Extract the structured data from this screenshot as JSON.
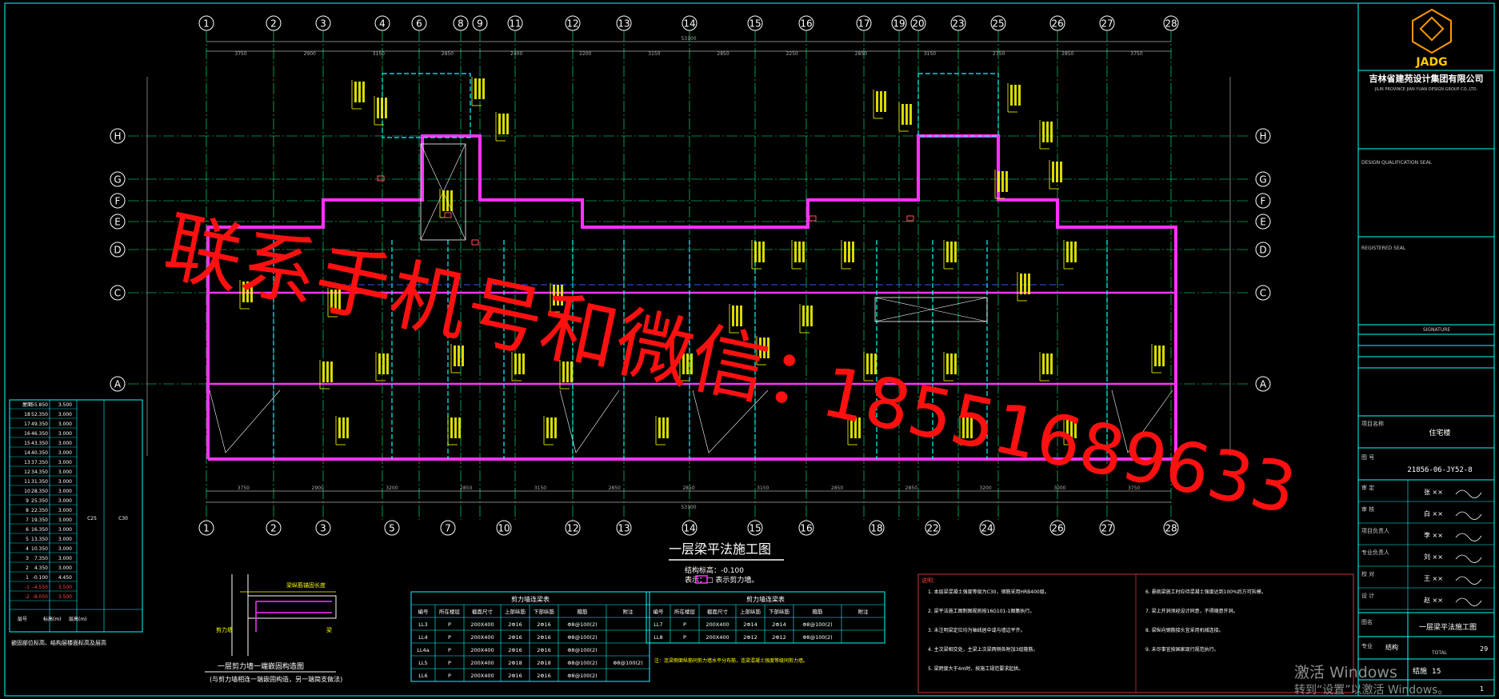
{
  "colors": {
    "background": "#000000",
    "wall": "#ff33ff",
    "grid_line": "#00ff88",
    "bubble": "#ffffff",
    "beam_dash": "#00ffff",
    "annotation": "#ffff00",
    "frame": "#00ffff",
    "dimension": "#aaaaaa",
    "watermark": "#ff1010",
    "windows_note": "#8f8f8f"
  },
  "watermark": {
    "line1": "联系手机号和微信：",
    "line2": "18551689633"
  },
  "grid_top": [
    "1",
    "2",
    "3",
    "4",
    "6",
    "8",
    "9",
    "11",
    "12",
    "13",
    "14",
    "15",
    "16",
    "17",
    "19",
    "20",
    "23",
    "25",
    "26",
    "27",
    "28"
  ],
  "grid_bottom": [
    "1",
    "2",
    "3",
    "5",
    "7",
    "10",
    "12",
    "13",
    "14",
    "15",
    "16",
    "18",
    "22",
    "24",
    "26",
    "27",
    "28"
  ],
  "grid_rows": [
    "H",
    "G",
    "F",
    "E",
    "D",
    "C",
    "A"
  ],
  "dims_top": [
    "3750",
    "2900",
    "3150",
    "2850",
    "2400",
    "2200",
    "3150",
    "2850",
    "2250",
    "2850",
    "3150",
    "2750",
    "2850",
    "3750"
  ],
  "dims_top_total": "53100",
  "dims_bottom": [
    "3750",
    "2900",
    "3200",
    "2850",
    "3150",
    "2850",
    "2850",
    "3150",
    "2850",
    "2850",
    "3200",
    "3000",
    "3750"
  ],
  "dims_bottom_total": "53100",
  "drawing_title": "一层梁平法施工图",
  "drawing_subtitle": "结构标高：-0.100",
  "legend_note": "表示：□ 表示剪力墙。",
  "floor_table": {
    "rows": [
      [
        "屋面",
        "55.850",
        "3.500"
      ],
      [
        "18",
        "52.350",
        "3.000"
      ],
      [
        "17",
        "49.350",
        "3.000"
      ],
      [
        "16",
        "46.350",
        "3.000"
      ],
      [
        "15",
        "43.350",
        "3.000"
      ],
      [
        "14",
        "40.350",
        "3.000"
      ],
      [
        "13",
        "37.350",
        "3.000"
      ],
      [
        "12",
        "34.350",
        "3.000"
      ],
      [
        "11",
        "31.350",
        "3.000"
      ],
      [
        "10",
        "28.350",
        "3.000"
      ],
      [
        "9",
        "25.350",
        "3.000"
      ],
      [
        "8",
        "22.350",
        "3.000"
      ],
      [
        "7",
        "19.350",
        "3.000"
      ],
      [
        "6",
        "16.350",
        "3.000"
      ],
      [
        "5",
        "13.350",
        "3.000"
      ],
      [
        "4",
        "10.350",
        "3.000"
      ],
      [
        "3",
        "7.350",
        "3.000"
      ],
      [
        "2",
        "4.350",
        "3.000"
      ],
      [
        "1",
        "-0.100",
        "4.450"
      ],
      [
        "-1",
        "-4.550",
        "3.500"
      ],
      [
        "-2",
        "-8.050",
        "3.500"
      ]
    ],
    "header": [
      "层号",
      "标高(m)",
      "层高(m)"
    ],
    "side_labels": [
      "C25",
      "C30"
    ],
    "caption": "嵌固部位标高、结构层楼面标高及层高"
  },
  "section_detail": {
    "caption": "一层剪力墙一端嵌固构造图",
    "caption2": "(与剪力墙相连一端嵌固构造，另一端简支做法)",
    "labels": [
      "梁纵筋锚固长度",
      "剪力墙",
      "梁"
    ]
  },
  "beam_table_left": {
    "title": "剪力墙连梁表",
    "header": [
      "编号",
      "所在楼层",
      "截面尺寸",
      "上部纵筋",
      "下部纵筋",
      "箍筋",
      "附注"
    ],
    "rows": [
      [
        "LL3",
        "P",
        "200X400",
        "2Φ16",
        "2Φ16",
        "Φ8@100(2)",
        ""
      ],
      [
        "LL4",
        "P",
        "200X400",
        "2Φ16",
        "2Φ16",
        "Φ8@100(2)",
        ""
      ],
      [
        "LL4a",
        "P",
        "200X400",
        "2Φ16",
        "2Φ16",
        "Φ8@100(2)",
        ""
      ],
      [
        "LL5",
        "P",
        "200X400",
        "2Φ18",
        "2Φ18",
        "Φ8@100(2)",
        "Φ8@100(2)"
      ],
      [
        "LL6",
        "P",
        "200X400",
        "2Φ16",
        "2Φ16",
        "Φ8@100(2)",
        ""
      ]
    ]
  },
  "beam_table_right": {
    "title": "剪力墙连梁表",
    "header": [
      "编号",
      "所在楼层",
      "截面尺寸",
      "上部纵筋",
      "下部纵筋",
      "箍筋",
      "附注"
    ],
    "rows": [
      [
        "LL7",
        "P",
        "200X400",
        "2Φ14",
        "2Φ14",
        "Φ8@100(2)",
        ""
      ],
      [
        "LL8",
        "P",
        "200X400",
        "2Φ12",
        "2Φ12",
        "Φ8@100(2)",
        ""
      ]
    ],
    "note": "注：连梁侧面纵筋同剪力墙水平分布筋，连梁混凝土强度等级同剪力墙。"
  },
  "notes_title": "说明：",
  "notes": [
    "1. 本层梁混凝土强度等级为C30，钢筋采用HRB400级。",
    "2. 梁平法施工图制图规则按16G101-1图集执行。",
    "3. 未注明梁定位均为轴线居中或与墙边平齐。",
    "4. 主次梁相交处，主梁上次梁两侧各附加3组箍筋。",
    "5. 梁跨度大于4m时，按施工规范要求起拱。",
    "6. 悬挑梁施工时应待混凝土强度达到100%后方可拆模。",
    "7. 梁上开洞须经设计同意，不得随意开洞。",
    "8. 梁纵向钢筋接头宜采用机械连接。",
    "9. 未尽事宜按国家现行规范执行。"
  ],
  "title_block": {
    "logo_text": "JADG",
    "company_cn": "吉林省建苑设计集团有限公司",
    "company_en": "JILIN PROVINCE JIAN YUAN DESIGN GROUP CO.,LTD.",
    "qualification": "DESIGN QUALIFICATION SEAL",
    "registered_seal": "REGISTERED SEAL",
    "signature_label": "SIGNATURE",
    "project_label": "项目名称",
    "project_value": "住宅楼",
    "drawing_no_label": "图 号",
    "drawing_no": "21856-06-JY52-8",
    "sheet_title_label": "图名",
    "sheet_title": "一层梁平法施工图",
    "discipline_label": "专业",
    "discipline": "结构",
    "total_label": "TOTAL",
    "total_value": "29",
    "page_label": "结施",
    "page_value": "15",
    "version_value": "1",
    "role_rows": [
      [
        "审 定",
        "张 ××"
      ],
      [
        "审 核",
        "白 ××"
      ],
      [
        "项目负责人",
        "李 ××"
      ],
      [
        "专业负责人",
        "刘 ××"
      ],
      [
        "校 对",
        "王 ××"
      ],
      [
        "设 计",
        "赵 ××"
      ]
    ]
  },
  "windows_activation": {
    "line1": "激活 Windows",
    "line2": "转到“设置”以激活 Windows。"
  }
}
